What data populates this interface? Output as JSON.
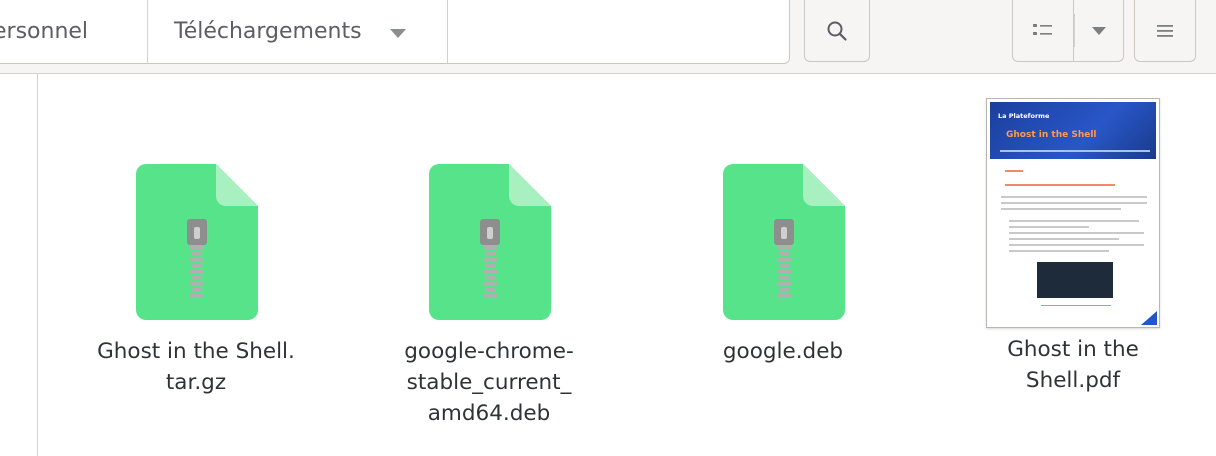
{
  "pathbar": {
    "crumbs": [
      {
        "label": "ersonnel"
      },
      {
        "label": "Téléchargements"
      }
    ]
  },
  "toolbar": {
    "search_icon": "search-icon",
    "view_icon": "list-view-icon",
    "view_menu_icon": "chevron-down-icon",
    "main_menu_icon": "hamburger-menu-icon"
  },
  "files": [
    {
      "name": "Ghost in the Shell.\ntar.gz",
      "icon": "archive-zip-icon"
    },
    {
      "name": "google-chrome-\nstable_current_\namd64.deb",
      "icon": "archive-zip-icon"
    },
    {
      "name": "google.deb",
      "icon": "archive-zip-icon"
    },
    {
      "name": "Ghost in the Shell.pdf",
      "icon": "pdf-thumbnail"
    }
  ],
  "thumbnail": {
    "logo": "La Plateforme",
    "title": "Ghost in the Shell"
  },
  "colors": {
    "archive_green": "#57e389",
    "archive_fold": "#a8f0c0",
    "zipper": "#8e8e8e",
    "text": "#2e3436",
    "header_bg": "#f6f5f4"
  }
}
